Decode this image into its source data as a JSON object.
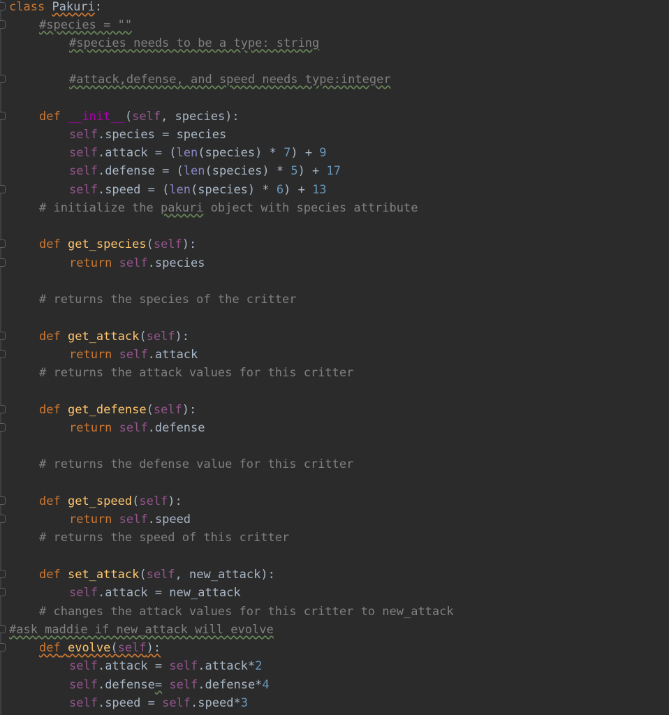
{
  "editor": {
    "language": "python",
    "class_name": "Pakuri",
    "lines": {
      "l1_kw": "class",
      "l1_name": "Pakuri",
      "l1_colon": ":",
      "l2": "#species = \"\"",
      "l3": "#species needs to be a type: string",
      "l5": "#attack,defense, and speed needs type:integer",
      "l7_def": "def",
      "l7_name": "__init__",
      "l7_open": "(",
      "l7_self": "self",
      "l7_rest": ", species):",
      "l8_self": "self",
      "l8_rest": ".species = species",
      "l9_self": "self",
      "l9_a": ".attack = (",
      "l9_len": "len",
      "l9_b": "(species) * ",
      "l9_n1": "7",
      "l9_c": ") + ",
      "l9_n2": "9",
      "l10_self": "self",
      "l10_a": ".defense = (",
      "l10_len": "len",
      "l10_b": "(species) * ",
      "l10_n1": "5",
      "l10_c": ") + ",
      "l10_n2": "17",
      "l11_self": "self",
      "l11_a": ".speed = (",
      "l11_len": "len",
      "l11_b": "(species) * ",
      "l11_n1": "6",
      "l11_c": ") + ",
      "l11_n2": "13",
      "l12_a": "# initialize the ",
      "l12_b": "pakuri",
      "l12_c": " object with species attribute",
      "l14_def": "def",
      "l14_name": "get_species",
      "l14_open": "(",
      "l14_self": "self",
      "l14_close": "):",
      "l15_ret": "return",
      "l15_self": "self",
      "l15_rest": ".species",
      "l17": "# returns the species of the critter",
      "l19_def": "def",
      "l19_name": "get_attack",
      "l19_open": "(",
      "l19_self": "self",
      "l19_close": "):",
      "l20_ret": "return",
      "l20_self": "self",
      "l20_rest": ".attack",
      "l21": "# returns the attack values for this critter",
      "l23_def": "def",
      "l23_name": "get_defense",
      "l23_open": "(",
      "l23_self": "self",
      "l23_close": "):",
      "l24_ret": "return",
      "l24_self": "self",
      "l24_rest": ".defense",
      "l26": "# returns the defense value for this critter",
      "l28_def": "def",
      "l28_name": "get_speed",
      "l28_open": "(",
      "l28_self": "self",
      "l28_close": "):",
      "l29_ret": "return",
      "l29_self": "self",
      "l29_rest": ".speed",
      "l30": "# returns the speed of this critter",
      "l32_def": "def",
      "l32_name": "set_attack",
      "l32_open": "(",
      "l32_self": "self",
      "l32_rest": ", new_attack):",
      "l33_self": "self",
      "l33_rest": ".attack = new_attack",
      "l34": "# changes the attack values for this critter to new_attack",
      "l35": "#ask maddie if new_attack will evolve",
      "l36_def": "def",
      "l36_name": "evolve",
      "l36_open": "(",
      "l36_self": "self",
      "l36_close": "):",
      "l37_self": "self",
      "l37_a": ".attack = ",
      "l37_self2": "self",
      "l37_b": ".attack*",
      "l37_n": "2",
      "l38_self": "self",
      "l38_a": ".defense",
      "l38_eq": "=",
      "l38_sp": " ",
      "l38_self2": "self",
      "l38_b": ".defense*",
      "l38_n": "4",
      "l39_self": "self",
      "l39_a": ".speed = ",
      "l39_self2": "self",
      "l39_b": ".speed*",
      "l39_n": "3"
    }
  }
}
